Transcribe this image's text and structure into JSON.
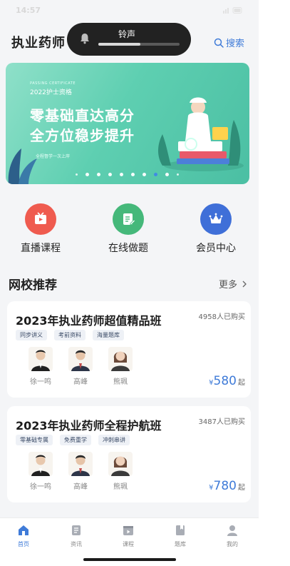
{
  "status_bar": {
    "time": "14:57"
  },
  "header": {
    "title": "执业药师",
    "search_label": "搜索"
  },
  "ringer": {
    "label": "铃声",
    "level": 0.52
  },
  "banner": {
    "tag_en": "PASSING CERTIFICATE",
    "cert": "2022护士资格",
    "headline_1": "零基础直达高分",
    "headline_2": "全方位稳步提升",
    "sub": "全程督学一次上岸",
    "page_count": 10,
    "active_index": 7
  },
  "quick_menu": [
    {
      "label": "直播课程",
      "icon": "live-play-icon",
      "color": "#ef5b4f"
    },
    {
      "label": "在线做题",
      "icon": "edit-document-icon",
      "color": "#45b87a"
    },
    {
      "label": "会员中心",
      "icon": "crown-icon",
      "color": "#3f6fd8"
    }
  ],
  "section": {
    "title": "网校推荐",
    "more": "更多"
  },
  "courses": [
    {
      "title": "2023年执业药师超值精品班",
      "buyers": "4958人已购买",
      "tags": [
        "同步讲义",
        "考前资料",
        "海量题库"
      ],
      "teachers": [
        "徐一鸣",
        "高峰",
        "熊珮"
      ],
      "currency": "¥",
      "price": "580",
      "price_suffix": "起"
    },
    {
      "title": "2023年执业药师全程护航班",
      "buyers": "3487人已购买",
      "tags": [
        "零基础专属",
        "免费重学",
        "冲刺串讲"
      ],
      "teachers": [
        "徐一鸣",
        "高峰",
        "熊珮"
      ],
      "currency": "¥",
      "price": "780",
      "price_suffix": "起"
    }
  ],
  "tabbar": [
    {
      "label": "首页",
      "icon": "home-icon",
      "active": true
    },
    {
      "label": "资讯",
      "icon": "news-icon",
      "active": false
    },
    {
      "label": "课程",
      "icon": "video-icon",
      "active": false
    },
    {
      "label": "题库",
      "icon": "question-bank-icon",
      "active": false
    },
    {
      "label": "我的",
      "icon": "profile-icon",
      "active": false
    }
  ],
  "colors": {
    "accent": "#3f7bd8",
    "banner": "#5ecfb1"
  }
}
